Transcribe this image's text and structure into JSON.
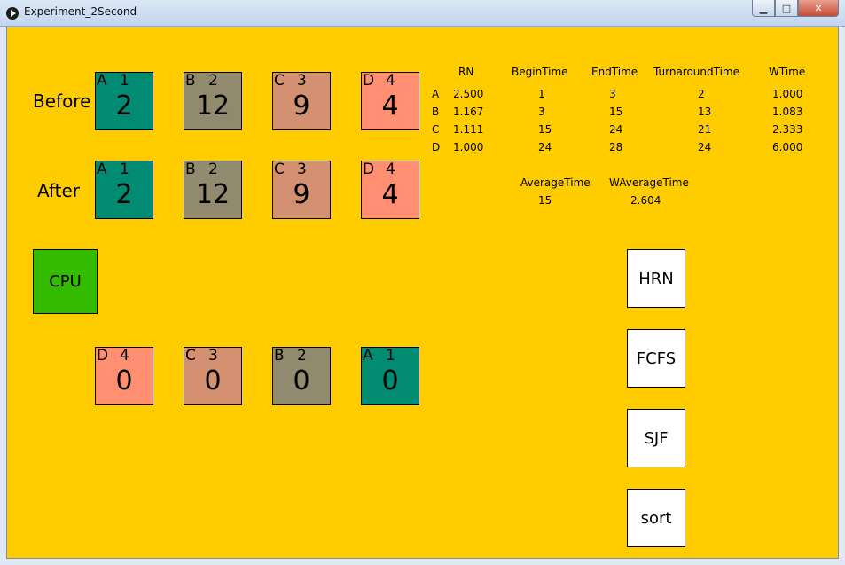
{
  "window": {
    "title": "Experiment_2Second"
  },
  "labels": {
    "before": "Before",
    "after": "After",
    "cpu": "CPU"
  },
  "colors": {
    "A": "#008b72",
    "B": "#918a6e",
    "C": "#d49171",
    "D": "#ff8f70",
    "background": "#ffcc00",
    "cpu": "#33bb00"
  },
  "before": [
    {
      "name": "A",
      "prio": "1",
      "val": "2"
    },
    {
      "name": "B",
      "prio": "2",
      "val": "12"
    },
    {
      "name": "C",
      "prio": "3",
      "val": "9"
    },
    {
      "name": "D",
      "prio": "4",
      "val": "4"
    }
  ],
  "after": [
    {
      "name": "A",
      "prio": "1",
      "val": "2"
    },
    {
      "name": "B",
      "prio": "2",
      "val": "12"
    },
    {
      "name": "C",
      "prio": "3",
      "val": "9"
    },
    {
      "name": "D",
      "prio": "4",
      "val": "4"
    }
  ],
  "queue": [
    {
      "name": "D",
      "prio": "4",
      "val": "0"
    },
    {
      "name": "C",
      "prio": "3",
      "val": "0"
    },
    {
      "name": "B",
      "prio": "2",
      "val": "0"
    },
    {
      "name": "A",
      "prio": "1",
      "val": "0"
    }
  ],
  "table": {
    "headers": [
      "RN",
      "BeginTime",
      "EndTime",
      "TurnaroundTime",
      "WTime"
    ],
    "rows": [
      {
        "id": "A",
        "rn": "2.500",
        "begin": "1",
        "end": "3",
        "turnaround": "2",
        "wtime": "1.000"
      },
      {
        "id": "B",
        "rn": "1.167",
        "begin": "3",
        "end": "15",
        "turnaround": "13",
        "wtime": "1.083"
      },
      {
        "id": "C",
        "rn": "1.111",
        "begin": "15",
        "end": "24",
        "turnaround": "21",
        "wtime": "2.333"
      },
      {
        "id": "D",
        "rn": "1.000",
        "begin": "24",
        "end": "28",
        "turnaround": "24",
        "wtime": "6.000"
      }
    ],
    "average_label": "AverageTime",
    "waverage_label": "WAverageTime",
    "average_value": "15",
    "waverage_value": "2.604"
  },
  "buttons": {
    "hrn": "HRN",
    "fcfs": "FCFS",
    "sjf": "SJF",
    "sort": "sort"
  }
}
